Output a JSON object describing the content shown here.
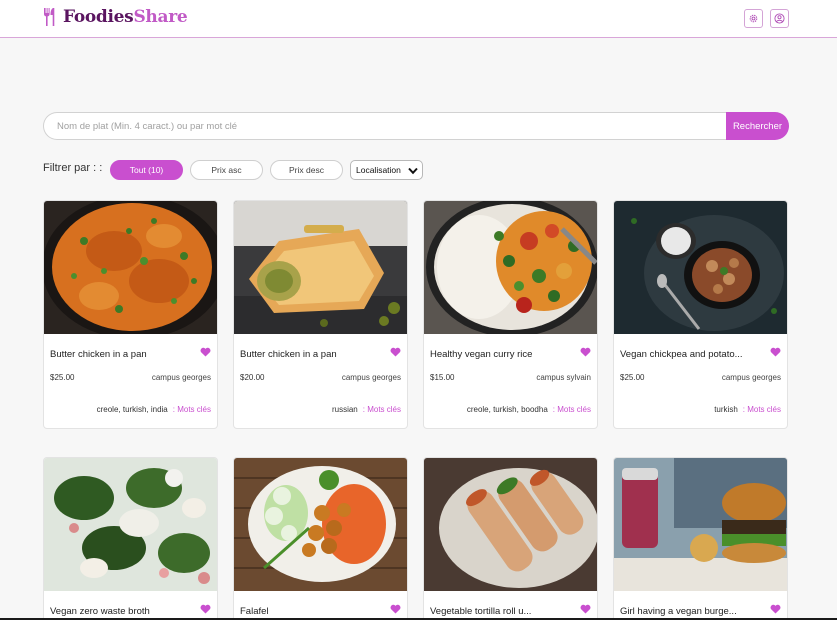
{
  "header": {
    "brand_part1": "Foodies",
    "brand_part2": "Share",
    "logo_icon": "fork-knife-icon",
    "settings_icon": "gear-icon",
    "profile_icon": "user-circle-icon"
  },
  "search": {
    "placeholder": "Nom de plat (Min. 4 caract.) ou par mot clé",
    "button": "Rechercher"
  },
  "filters": {
    "label": "Filtrer par : :",
    "all": "Tout (10)",
    "price_asc": "Prix asc",
    "price_desc": "Prix desc",
    "location": "Localisation"
  },
  "colors": {
    "accent": "#c94fcf",
    "brand_dark": "#5a1560"
  },
  "cards": [
    {
      "title": "Butter chicken in a pan",
      "price": "$25.00",
      "campus": "campus georges",
      "tags": "creole, turkish, india",
      "keywords_label": ": Mots clés"
    },
    {
      "title": "Butter chicken in a pan",
      "price": "$20.00",
      "campus": "campus georges",
      "tags": "russian",
      "keywords_label": ": Mots clés"
    },
    {
      "title": "Healthy vegan curry rice",
      "price": "$15.00",
      "campus": "campus sylvain",
      "tags": "creole, turkish, boodha",
      "keywords_label": ": Mots clés"
    },
    {
      "title": "Vegan chickpea and potato...",
      "price": "$25.00",
      "campus": "campus georges",
      "tags": "turkish",
      "keywords_label": ": Mots clés"
    },
    {
      "title": "Vegan zero waste broth"
    },
    {
      "title": "Falafel"
    },
    {
      "title": "Vegetable tortilla roll u..."
    },
    {
      "title": "Girl having a vegan burge..."
    }
  ]
}
